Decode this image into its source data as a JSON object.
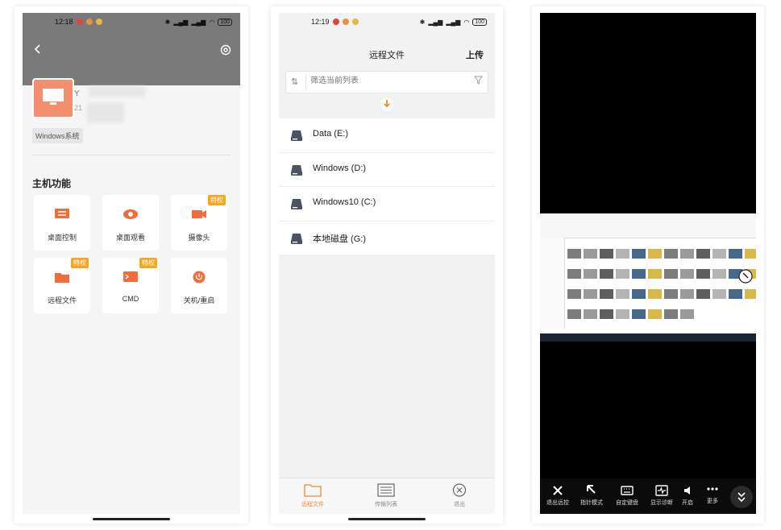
{
  "phone1": {
    "time": "12:18",
    "battery": "100",
    "host_name": "Y",
    "host_sub": "21",
    "os_tag": "Windows系统",
    "section_title": "主机功能",
    "features": [
      {
        "label": "桌面控制",
        "tag": ""
      },
      {
        "label": "桌面观看",
        "tag": ""
      },
      {
        "label": "摄像头",
        "tag": "特权"
      },
      {
        "label": "远程文件",
        "tag": "特权"
      },
      {
        "label": "CMD",
        "tag": "特权"
      },
      {
        "label": "关机/重启",
        "tag": ""
      }
    ],
    "accent": "#f26b3a",
    "tag_color": "#f5a623"
  },
  "phone2": {
    "time": "12:19",
    "battery": "100",
    "title": "远程文件",
    "upload_label": "上传",
    "filter_placeholder": "筛选当前列表",
    "drives": [
      "Data (E:)",
      "Windows (D:)",
      "Windows10 (C:)",
      "本地磁盘 (G:)"
    ],
    "tabs": [
      "远程文件",
      "传输列表",
      "退出"
    ],
    "active_color": "#f08b30"
  },
  "phone3": {
    "toolbar": [
      "退出远控",
      "指针模式",
      "自定键盘",
      "显示诊断",
      "开启",
      "更多"
    ]
  }
}
